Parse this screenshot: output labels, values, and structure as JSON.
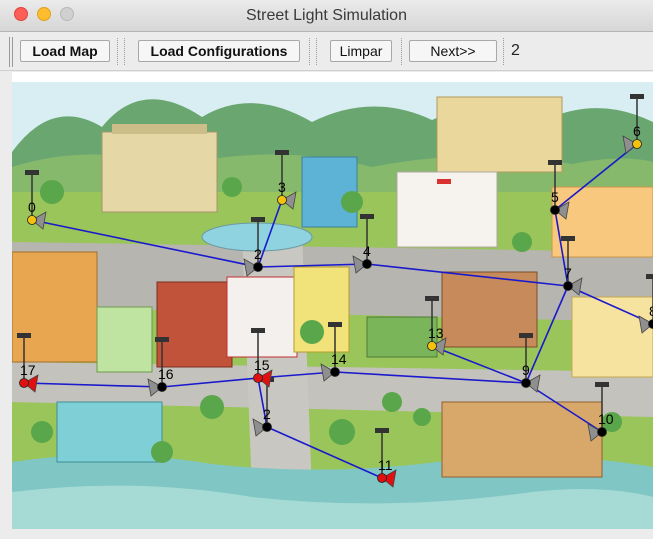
{
  "window": {
    "title": "Street Light Simulation"
  },
  "toolbar": {
    "load_map": "Load Map",
    "load_configurations": "Load Configurations",
    "limpar": "Limpar",
    "next": "Next>>",
    "step_value": "2"
  },
  "colors": {
    "edge": "#1a1acc",
    "node": "#000000",
    "light_on": "#f4c20d",
    "light_fault": "#e01010"
  },
  "graph": {
    "nodes": [
      {
        "id": "0",
        "label": "0",
        "status": "on"
      },
      {
        "id": "2a",
        "label": "2",
        "status": "off"
      },
      {
        "id": "3",
        "label": "3",
        "status": "on"
      },
      {
        "id": "4",
        "label": "4",
        "status": "off"
      },
      {
        "id": "5",
        "label": "5",
        "status": "off"
      },
      {
        "id": "6",
        "label": "6",
        "status": "on"
      },
      {
        "id": "7",
        "label": "7",
        "status": "off"
      },
      {
        "id": "8",
        "label": "8",
        "status": "off"
      },
      {
        "id": "9",
        "label": "9",
        "status": "off"
      },
      {
        "id": "10",
        "label": "10",
        "status": "off"
      },
      {
        "id": "11",
        "label": "11",
        "status": "fault"
      },
      {
        "id": "12",
        "label": "2",
        "status": "off"
      },
      {
        "id": "13",
        "label": "13",
        "status": "on"
      },
      {
        "id": "14",
        "label": "14",
        "status": "off"
      },
      {
        "id": "15",
        "label": "15",
        "status": "fault"
      },
      {
        "id": "16",
        "label": "16",
        "status": "off"
      },
      {
        "id": "17",
        "label": "17",
        "status": "fault"
      }
    ],
    "edges": [
      [
        "0",
        "2a"
      ],
      [
        "2a",
        "3"
      ],
      [
        "2a",
        "4"
      ],
      [
        "4",
        "7"
      ],
      [
        "7",
        "5"
      ],
      [
        "5",
        "6"
      ],
      [
        "7",
        "8"
      ],
      [
        "7",
        "9"
      ],
      [
        "9",
        "10"
      ],
      [
        "9",
        "13"
      ],
      [
        "9",
        "14"
      ],
      [
        "14",
        "15"
      ],
      [
        "15",
        "16"
      ],
      [
        "16",
        "17"
      ],
      [
        "15",
        "12"
      ],
      [
        "12",
        "11"
      ]
    ]
  }
}
